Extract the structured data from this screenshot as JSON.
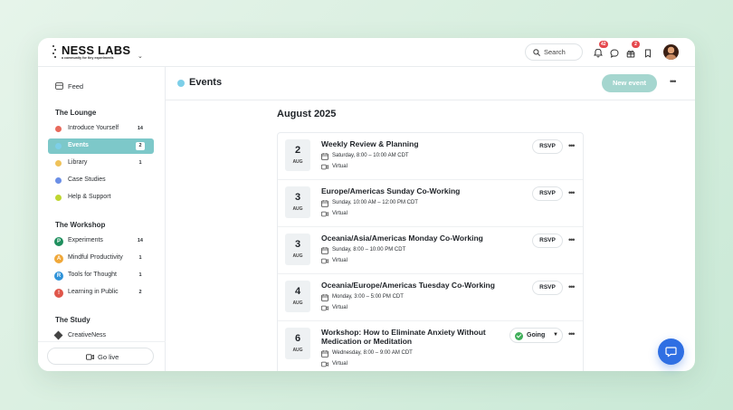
{
  "brand": {
    "name": "NESS LABS",
    "tagline": "a community for tiny experiments"
  },
  "topbar": {
    "search_label": "Search",
    "notifications_count": "42",
    "updates_count": "2"
  },
  "sidebar": {
    "feed_label": "Feed",
    "sections": [
      {
        "title": "The Lounge",
        "items": [
          {
            "label": "Introduce Yourself",
            "count": "14",
            "icon": "dot",
            "color": "#e86a5c"
          },
          {
            "label": "Events",
            "count": "2",
            "icon": "dot",
            "color": "#7dcfe8",
            "active": true
          },
          {
            "label": "Library",
            "count": "1",
            "icon": "dot",
            "color": "#efc25a"
          },
          {
            "label": "Case Studies",
            "count": "",
            "icon": "dot",
            "color": "#6b8fe6"
          },
          {
            "label": "Help & Support",
            "count": "",
            "icon": "dot",
            "color": "#bfd631"
          }
        ]
      },
      {
        "title": "The Workshop",
        "items": [
          {
            "label": "Experiments",
            "count": "14",
            "icon": "P",
            "color": "#1f8f5e"
          },
          {
            "label": "Mindful Productivity",
            "count": "1",
            "icon": "A",
            "color": "#f0a83a"
          },
          {
            "label": "Tools for Thought",
            "count": "1",
            "icon": "R",
            "color": "#2f93d9"
          },
          {
            "label": "Learning in Public",
            "count": "2",
            "icon": "!",
            "color": "#e0564a"
          }
        ]
      },
      {
        "title": "The Study",
        "items": [
          {
            "label": "CreativeNess",
            "count": "",
            "icon": "diamond",
            "color": "#444444"
          }
        ]
      }
    ],
    "go_live_label": "Go live"
  },
  "main": {
    "title": "Events",
    "title_dot_color": "#7dcfe8",
    "new_event_label": "New event",
    "month_heading": "August 2025",
    "events": [
      {
        "day": "2",
        "month": "AUG",
        "title": "Weekly Review & Planning",
        "when": "Saturday, 8:00 – 10:00 AM CDT",
        "where": "Virtual",
        "action": "RSVP"
      },
      {
        "day": "3",
        "month": "AUG",
        "title": "Europe/Americas Sunday Co-Working",
        "when": "Sunday, 10:00 AM – 12:00 PM CDT",
        "where": "Virtual",
        "action": "RSVP"
      },
      {
        "day": "3",
        "month": "AUG",
        "title": "Oceania/Asia/Americas Monday Co-Working",
        "when": "Sunday, 8:00 – 10:00 PM CDT",
        "where": "Virtual",
        "action": "RSVP"
      },
      {
        "day": "4",
        "month": "AUG",
        "title": "Oceania/Europe/Americas Tuesday Co-Working",
        "when": "Monday, 3:00 – 5:00 PM CDT",
        "where": "Virtual",
        "action": "RSVP"
      },
      {
        "day": "6",
        "month": "AUG",
        "title": "Workshop: How to Eliminate Anxiety Without Medication or Meditation",
        "when": "Wednesday, 8:00 – 9:00 AM CDT",
        "where": "Virtual",
        "action": "Going"
      }
    ]
  },
  "colors": {
    "accent": "#7dc8c9",
    "new_event_button": "#a5d6cf",
    "chat_button": "#2f6fe3",
    "going_check": "#3fae5a"
  },
  "icons": {
    "search": "search-icon",
    "bell": "bell-icon",
    "chat": "chat-bubble-icon",
    "gift": "gift-icon",
    "bookmark": "bookmark-icon",
    "calendar": "calendar-icon",
    "video": "video-camera-icon",
    "more": "more-horizontal-icon"
  }
}
